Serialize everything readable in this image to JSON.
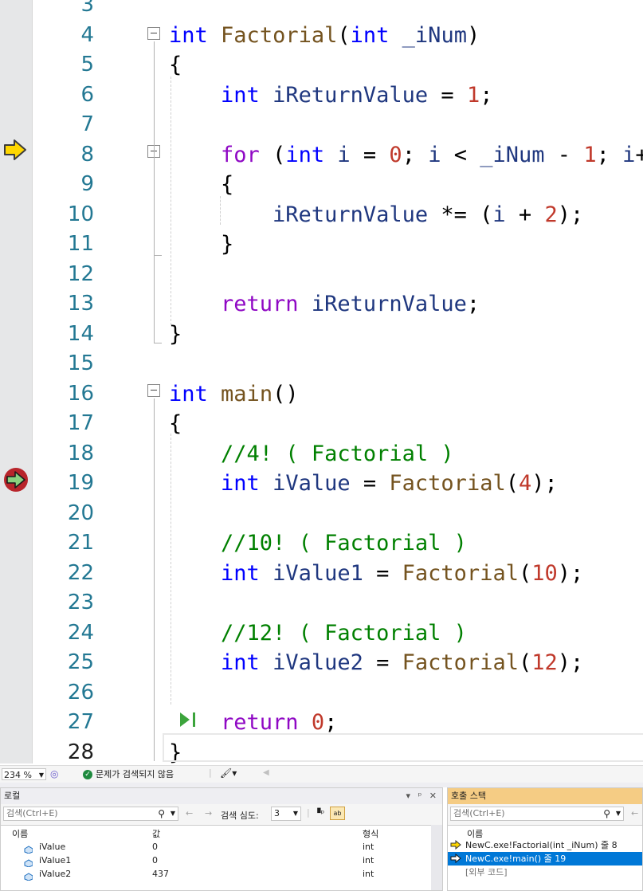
{
  "editor": {
    "lines": [
      {
        "n": "3",
        "tokens": []
      },
      {
        "n": "4",
        "tokens": [
          [
            "int",
            "kw"
          ],
          [
            " ",
            "pun"
          ],
          [
            "Factorial",
            "fn"
          ],
          [
            "(",
            "pun"
          ],
          [
            "int",
            "kw"
          ],
          [
            " ",
            "pun"
          ],
          [
            "_iNum",
            "var"
          ],
          [
            ")",
            "pun"
          ]
        ]
      },
      {
        "n": "5",
        "tokens": [
          [
            "{",
            "pun"
          ]
        ]
      },
      {
        "n": "6",
        "tokens": [
          [
            "    ",
            "pun"
          ],
          [
            "int",
            "kw"
          ],
          [
            " ",
            "pun"
          ],
          [
            "iReturnValue",
            "var"
          ],
          [
            " = ",
            "pun"
          ],
          [
            "1",
            "num"
          ],
          [
            ";",
            "pun"
          ]
        ]
      },
      {
        "n": "7",
        "tokens": []
      },
      {
        "n": "8",
        "tokens": [
          [
            "    ",
            "pun"
          ],
          [
            "for",
            "ctl"
          ],
          [
            " (",
            "pun"
          ],
          [
            "int",
            "kw"
          ],
          [
            " ",
            "pun"
          ],
          [
            "i",
            "var"
          ],
          [
            " = ",
            "pun"
          ],
          [
            "0",
            "num"
          ],
          [
            "; ",
            "pun"
          ],
          [
            "i",
            "var"
          ],
          [
            " < ",
            "pun"
          ],
          [
            "_iNum",
            "var"
          ],
          [
            " - ",
            "pun"
          ],
          [
            "1",
            "num"
          ],
          [
            "; ",
            "pun"
          ],
          [
            "i",
            "var"
          ],
          [
            "++)",
            "pun"
          ]
        ]
      },
      {
        "n": "9",
        "tokens": [
          [
            "    {",
            "pun"
          ]
        ]
      },
      {
        "n": "10",
        "tokens": [
          [
            "        ",
            "pun"
          ],
          [
            "iReturnValue",
            "var"
          ],
          [
            " *= (",
            "pun"
          ],
          [
            "i",
            "var"
          ],
          [
            " + ",
            "pun"
          ],
          [
            "2",
            "num"
          ],
          [
            ");",
            "pun"
          ]
        ]
      },
      {
        "n": "11",
        "tokens": [
          [
            "    }",
            "pun"
          ]
        ]
      },
      {
        "n": "12",
        "tokens": []
      },
      {
        "n": "13",
        "tokens": [
          [
            "    ",
            "pun"
          ],
          [
            "return",
            "ctl"
          ],
          [
            " ",
            "pun"
          ],
          [
            "iReturnValue",
            "var"
          ],
          [
            ";",
            "pun"
          ]
        ]
      },
      {
        "n": "14",
        "tokens": [
          [
            "}",
            "pun"
          ]
        ]
      },
      {
        "n": "15",
        "tokens": []
      },
      {
        "n": "16",
        "tokens": [
          [
            "int",
            "kw"
          ],
          [
            " ",
            "pun"
          ],
          [
            "main",
            "fn"
          ],
          [
            "()",
            "pun"
          ]
        ]
      },
      {
        "n": "17",
        "tokens": [
          [
            "{",
            "pun"
          ]
        ]
      },
      {
        "n": "18",
        "tokens": [
          [
            "    ",
            "pun"
          ],
          [
            "//4! ( Factorial )",
            "cm"
          ]
        ]
      },
      {
        "n": "19",
        "tokens": [
          [
            "    ",
            "pun"
          ],
          [
            "int",
            "kw"
          ],
          [
            " ",
            "pun"
          ],
          [
            "iValue",
            "var"
          ],
          [
            " = ",
            "pun"
          ],
          [
            "Factorial",
            "fn"
          ],
          [
            "(",
            "pun"
          ],
          [
            "4",
            "num"
          ],
          [
            ");",
            "pun"
          ]
        ]
      },
      {
        "n": "20",
        "tokens": []
      },
      {
        "n": "21",
        "tokens": [
          [
            "    ",
            "pun"
          ],
          [
            "//10! ( Factorial )",
            "cm"
          ]
        ]
      },
      {
        "n": "22",
        "tokens": [
          [
            "    ",
            "pun"
          ],
          [
            "int",
            "kw"
          ],
          [
            " ",
            "pun"
          ],
          [
            "iValue1",
            "var"
          ],
          [
            " = ",
            "pun"
          ],
          [
            "Factorial",
            "fn"
          ],
          [
            "(",
            "pun"
          ],
          [
            "10",
            "num"
          ],
          [
            ");",
            "pun"
          ]
        ]
      },
      {
        "n": "23",
        "tokens": []
      },
      {
        "n": "24",
        "tokens": [
          [
            "    ",
            "pun"
          ],
          [
            "//12! ( Factorial )",
            "cm"
          ]
        ]
      },
      {
        "n": "25",
        "tokens": [
          [
            "    ",
            "pun"
          ],
          [
            "int",
            "kw"
          ],
          [
            " ",
            "pun"
          ],
          [
            "iValue2",
            "var"
          ],
          [
            " = ",
            "pun"
          ],
          [
            "Factorial",
            "fn"
          ],
          [
            "(",
            "pun"
          ],
          [
            "12",
            "num"
          ],
          [
            ");",
            "pun"
          ]
        ]
      },
      {
        "n": "26",
        "tokens": []
      },
      {
        "n": "27",
        "tokens": [
          [
            "    ",
            "pun"
          ],
          [
            "return",
            "ctl"
          ],
          [
            " ",
            "pun"
          ],
          [
            "0",
            "num"
          ],
          [
            ";",
            "pun"
          ]
        ]
      },
      {
        "n": "28",
        "tokens": [
          [
            "}",
            "pun"
          ]
        ]
      }
    ],
    "current_line": "28",
    "colors": {
      "keyword": "#0000ff",
      "control": "#8f08c4",
      "function": "#74531f",
      "variable": "#1f377f",
      "number": "#c0392b",
      "comment": "#008000",
      "line_number": "#237893"
    },
    "icons": {
      "current_statement": "yellow-arrow-icon",
      "call_return": "breakpoint-return-icon",
      "run_to_click": "run-to-click-icon"
    }
  },
  "status": {
    "zoom": "234 %",
    "issues": "문제가 검색되지 않음"
  },
  "locals": {
    "title": "로컬",
    "title_buttons": "▾ ᵖ ✕",
    "search_placeholder": "검색(Ctrl+E)",
    "depth_label": "검색 심도:",
    "depth_value": "3",
    "columns": {
      "name": "이름",
      "value": "값",
      "type": "형식"
    },
    "rows": [
      {
        "name": "iValue",
        "value": "0",
        "type": "int"
      },
      {
        "name": "iValue1",
        "value": "0",
        "type": "int"
      },
      {
        "name": "iValue2",
        "value": "437",
        "type": "int"
      }
    ]
  },
  "callstack": {
    "title": "호출 스택",
    "search_placeholder": "검색(Ctrl+E)",
    "columns": {
      "name": "이름"
    },
    "frames": [
      {
        "label": "NewC.exe!Factorial(int _iNum) 줄 8",
        "icon": "yellow-arrow-icon"
      },
      {
        "label": "NewC.exe!main() 줄 19",
        "icon": "return-arrow-icon"
      },
      {
        "label": "[외부 코드]",
        "icon": ""
      }
    ]
  }
}
